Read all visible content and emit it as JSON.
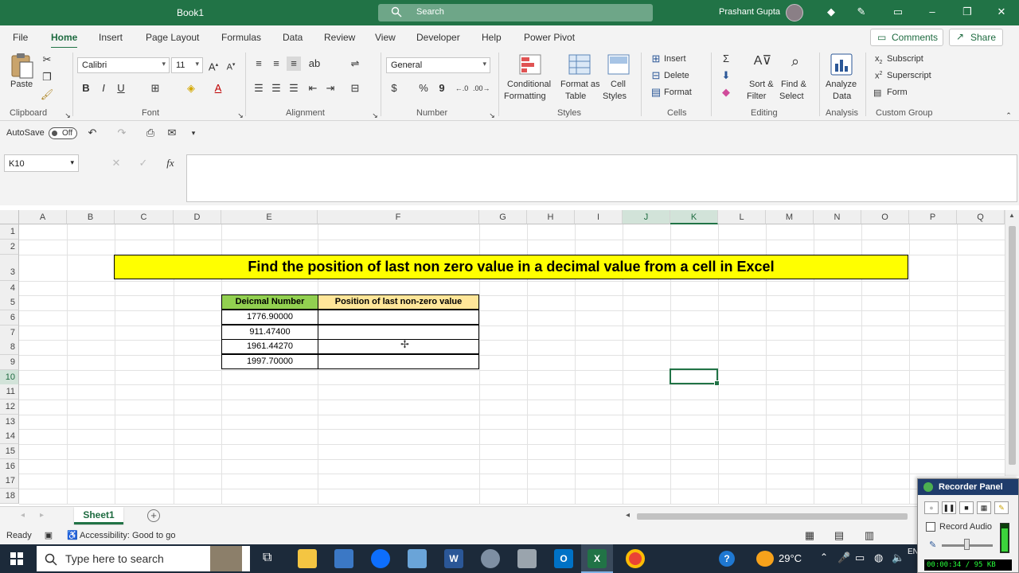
{
  "window": {
    "title": "Book1",
    "search_placeholder": "Search",
    "user_name": "Prashant Gupta"
  },
  "menu": {
    "tabs": [
      "File",
      "Home",
      "Insert",
      "Page Layout",
      "Formulas",
      "Data",
      "Review",
      "View",
      "Developer",
      "Help",
      "Power Pivot"
    ],
    "active_tab": "Home",
    "comments": "Comments",
    "share": "Share"
  },
  "ribbon": {
    "clipboard": {
      "paste": "Paste",
      "label": "Clipboard"
    },
    "font": {
      "name": "Calibri",
      "size": "11",
      "label": "Font",
      "bold": "B",
      "italic": "I",
      "underline": "U"
    },
    "alignment": {
      "label": "Alignment"
    },
    "number": {
      "format": "General",
      "label": "Number"
    },
    "styles": {
      "conditional": "Conditional",
      "conditional2": "Formatting",
      "format_as": "Format as",
      "format_as2": "Table",
      "cell": "Cell",
      "cell2": "Styles",
      "label": "Styles"
    },
    "cells": {
      "insert": "Insert",
      "delete": "Delete",
      "format": "Format",
      "label": "Cells"
    },
    "editing": {
      "sort": "Sort &",
      "sort2": "Filter",
      "find": "Find &",
      "find2": "Select",
      "label": "Editing"
    },
    "analysis": {
      "analyze": "Analyze",
      "analyze2": "Data",
      "label": "Analysis"
    },
    "custom": {
      "subscript": "Subscript",
      "superscript": "Superscript",
      "form": "Form",
      "label": "Custom Group"
    }
  },
  "qat": {
    "autosave": "AutoSave",
    "toggle": "Off"
  },
  "formula_bar": {
    "name_box": "K10",
    "fx": "fx",
    "content": ""
  },
  "sheet": {
    "columns": [
      "A",
      "B",
      "C",
      "D",
      "E",
      "F",
      "G",
      "H",
      "I",
      "J",
      "K",
      "L",
      "M",
      "N",
      "O",
      "P",
      "Q"
    ],
    "rows": [
      "1",
      "2",
      "3",
      "4",
      "5",
      "6",
      "7",
      "8",
      "9",
      "10",
      "11",
      "12",
      "13",
      "14",
      "15",
      "16",
      "17",
      "18"
    ],
    "title": "Find the position of last non zero value in a decimal value from a cell in Excel",
    "table": {
      "headers": [
        "Deicmal Number",
        "Position of last non-zero value"
      ],
      "rows": [
        [
          "1776.90000",
          ""
        ],
        [
          "911.47400",
          ""
        ],
        [
          "1961.44270",
          ""
        ],
        [
          "1997.70000",
          ""
        ]
      ],
      "header_colors": [
        "#92d050",
        "#ffe699"
      ]
    },
    "selected_cell": "K10"
  },
  "sheet_tabs": {
    "active": "Sheet1"
  },
  "status": {
    "ready": "Ready",
    "accessibility": "Accessibility: Good to go"
  },
  "taskbar": {
    "search": "Type here to search",
    "temp": "29°C",
    "lang": "EN"
  },
  "recorder": {
    "title": "Recorder Panel",
    "record_audio": "Record Audio",
    "timer": "00:00:34 / 95 KB"
  },
  "colors": {
    "excel_green": "#217346",
    "title_yellow": "#ffff00"
  }
}
